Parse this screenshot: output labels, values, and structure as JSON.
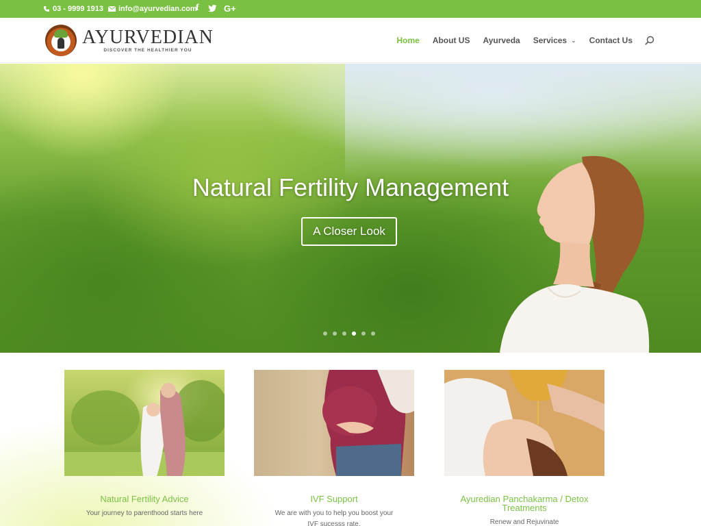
{
  "topbar": {
    "phone": "03 - 9999 1913",
    "email": "info@ayurvedian.com",
    "social": {
      "facebook": "f",
      "twitter": "twitter-icon",
      "google": "G+"
    }
  },
  "brand": {
    "name": "AYURVEDIAN",
    "tagline": "DISCOVER THE HEALTHIER YOU"
  },
  "nav": {
    "items": [
      {
        "label": "Home",
        "active": true
      },
      {
        "label": "About US"
      },
      {
        "label": "Ayurveda"
      },
      {
        "label": "Services",
        "has_dropdown": true
      },
      {
        "label": "Contact Us"
      }
    ]
  },
  "hero": {
    "title": "Natural Fertility Management",
    "button": "A Closer Look",
    "slides": 6,
    "active_slide": 4
  },
  "features": [
    {
      "title": "Natural Fertility Advice",
      "desc": "Your journey to parenthood starts here"
    },
    {
      "title": "IVF Support",
      "desc": "We are with you to help you boost your IVF sucesss rate."
    },
    {
      "title": "Ayuredian Panchakarma / Detox Treatments",
      "desc": "Renew and Rejuvinate"
    }
  ],
  "colors": {
    "accent": "#7ac143",
    "text": "#555555"
  }
}
